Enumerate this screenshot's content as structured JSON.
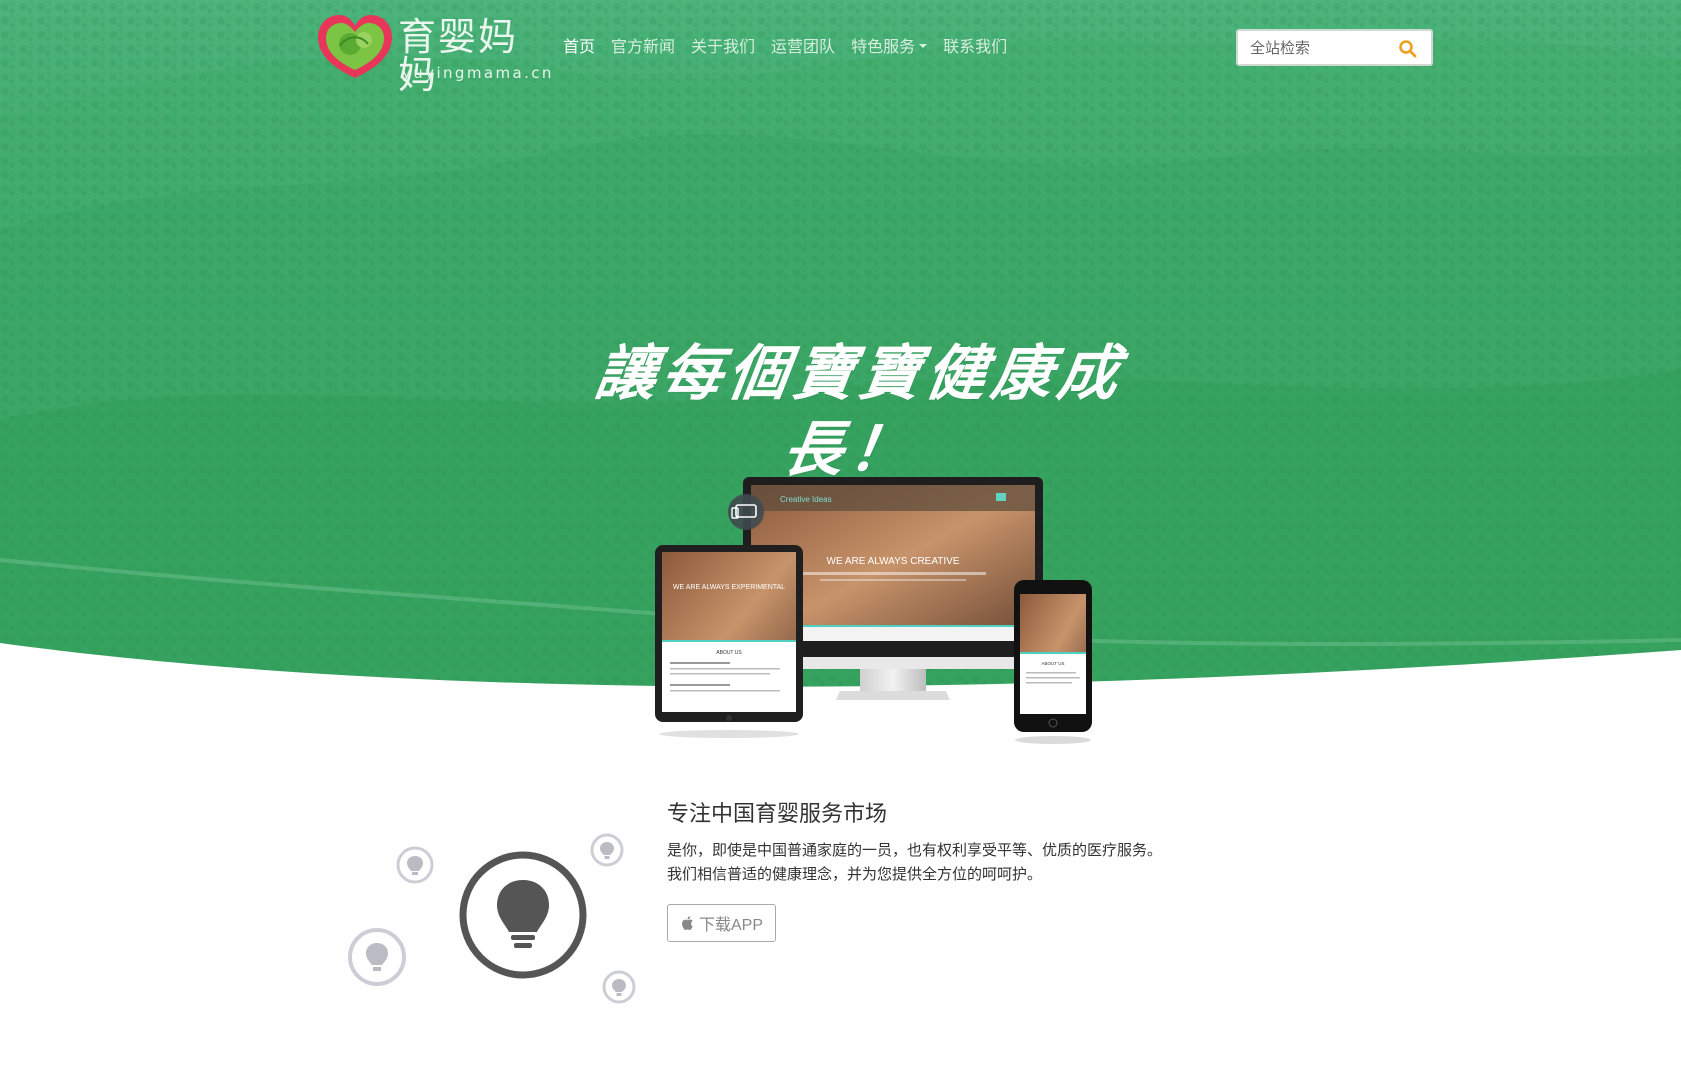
{
  "brand": {
    "name_cn": "育婴妈妈",
    "domain": "yuyingmama.cn"
  },
  "nav": {
    "items": [
      {
        "label": "首页",
        "active": true
      },
      {
        "label": "官方新闻"
      },
      {
        "label": "关于我们"
      },
      {
        "label": "运营团队"
      },
      {
        "label": "特色服务",
        "dropdown": true
      },
      {
        "label": "联系我们"
      }
    ]
  },
  "search": {
    "placeholder": "全站检索",
    "icon": "search-icon"
  },
  "hero": {
    "slogan": "讓每個寶寶健康成長！"
  },
  "devices": {
    "monitor_caption": "WE ARE ALWAYS CREATIVE",
    "monitor_brand": "Creative Ideas",
    "tablet_caption": "WE ARE ALWAYS EXPERIMENTAL",
    "tablet_section": "ABOUT US",
    "phone_caption": "ABOUT US"
  },
  "feature": {
    "title": "专注中国育婴服务市场",
    "desc_line1": "是你，即使是中国普通家庭的一员，也有权利享受平等、优质的医疗服务。",
    "desc_line2": "我们相信普适的健康理念，并为您提供全方位的呵呵护。",
    "button_label": "下载APP",
    "button_icon": "apple-icon"
  },
  "colors": {
    "hero_green": "#3aa864",
    "accent_orange": "#f0a020",
    "logo_red": "#e8355a"
  }
}
